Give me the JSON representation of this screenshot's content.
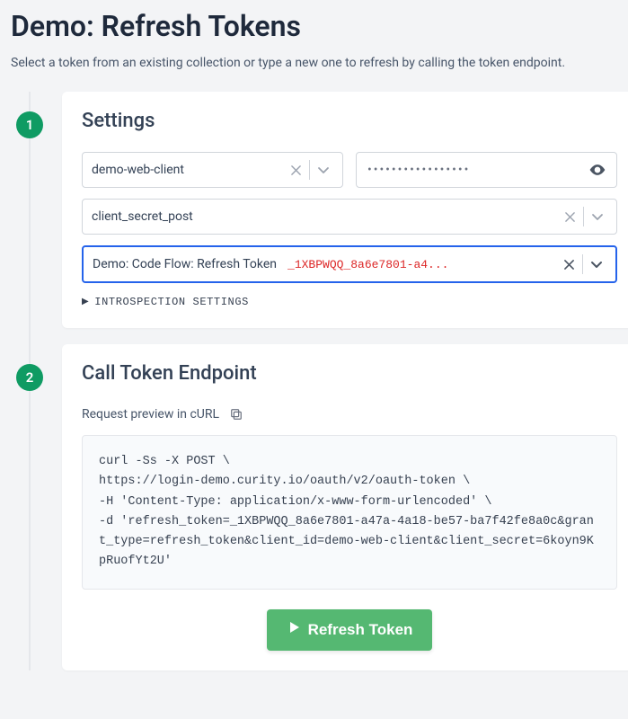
{
  "page": {
    "title": "Demo: Refresh Tokens",
    "subtitle": "Select a token from an existing collection or type a new one to refresh by calling the token endpoint."
  },
  "steps": {
    "settings": {
      "number": "1",
      "title": "Settings",
      "client_id": "demo-web-client",
      "client_secret_mask": "•••••••••••••••••",
      "auth_method": "client_secret_post",
      "token_collection_label": "Demo: Code Flow: Refresh Token",
      "token_value_preview": "_1XBPWQQ_8a6e7801-a4...",
      "introspection_label": "INTROSPECTION SETTINGS"
    },
    "call": {
      "number": "2",
      "title": "Call Token Endpoint",
      "preview_label": "Request preview in cURL",
      "curl": "curl -Ss -X POST \\\nhttps://login-demo.curity.io/oauth/v2/oauth-token \\\n-H 'Content-Type: application/x-www-form-urlencoded' \\\n-d 'refresh_token=_1XBPWQQ_8a6e7801-a47a-4a18-be57-ba7f42fe8a0c&grant_type=refresh_token&client_id=demo-web-client&client_secret=6koyn9KpRuofYt2U'",
      "button_label": "Refresh Token"
    }
  }
}
